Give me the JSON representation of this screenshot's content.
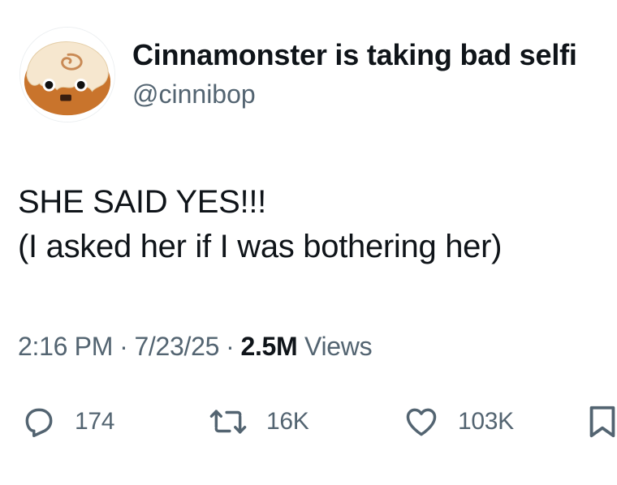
{
  "author": {
    "display_name": "Cinnamonster is taking bad selfi",
    "handle": "@cinnibop"
  },
  "tweet": {
    "line1": "SHE SAID YES!!!",
    "line2": "(I asked her if I was bothering her)"
  },
  "meta": {
    "time": "2:16 PM",
    "date": "7/23/25",
    "views_count": "2.5M",
    "views_label": "Views",
    "separator": "·"
  },
  "actions": {
    "replies": "174",
    "reposts": "16K",
    "likes": "103K"
  },
  "colors": {
    "text": "#0f1419",
    "secondary": "#536471"
  },
  "icons": [
    "reply-icon",
    "repost-icon",
    "like-icon",
    "bookmark-icon"
  ]
}
